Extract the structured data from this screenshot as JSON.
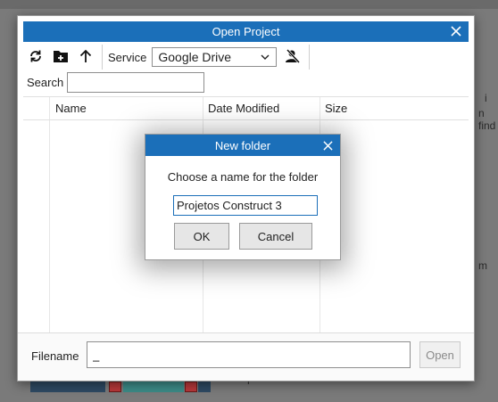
{
  "background": {
    "snippets": [
      "i",
      "n find",
      "m",
      "r"
    ]
  },
  "dialog": {
    "title": "Open Project",
    "toolbar": {
      "service_label": "Service",
      "service_value": "Google Drive"
    },
    "search": {
      "label": "Search",
      "value": ""
    },
    "table": {
      "columns": [
        "Name",
        "Date Modified",
        "Size"
      ],
      "rows": []
    },
    "footer": {
      "filename_label": "Filename",
      "filename_value": "_",
      "open_label": "Open"
    }
  },
  "new_folder": {
    "title": "New folder",
    "prompt": "Choose a name for the folder",
    "value": "Projetos Construct 3",
    "ok_label": "OK",
    "cancel_label": "Cancel"
  },
  "icons": {
    "close": "close-icon",
    "refresh": "refresh-icon",
    "new_folder": "new-folder-icon",
    "up": "arrow-up-icon",
    "chevron": "chevron-down-icon",
    "user_off": "user-off-icon"
  },
  "colors": {
    "accent": "#1b6fb9",
    "disabled_text": "#8a8a8a"
  }
}
